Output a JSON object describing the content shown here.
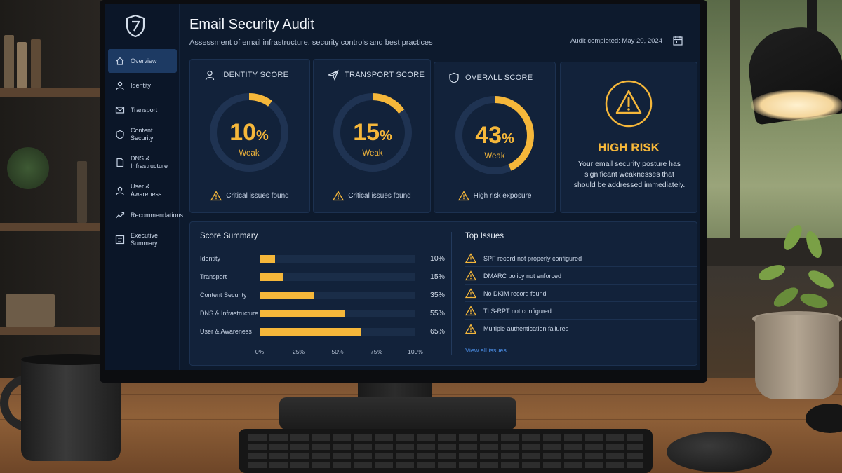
{
  "header": {
    "title": "Email Security Audit",
    "subtitle": "Assessment of email infrastructure, security controls and best practices",
    "audit_date": "Audit completed: May 20, 2024"
  },
  "sidebar": {
    "items": [
      {
        "label": "Overview",
        "icon": "home-icon",
        "active": true
      },
      {
        "label": "Identity",
        "icon": "user-icon",
        "active": false
      },
      {
        "label": "Transport",
        "icon": "mail-icon",
        "active": false
      },
      {
        "label": "Content Security",
        "icon": "shield-icon",
        "active": false
      },
      {
        "label": "DNS & Infrastructure",
        "icon": "document-icon",
        "active": false
      },
      {
        "label": "User & Awareness",
        "icon": "user-icon",
        "active": false
      },
      {
        "label": "Recommendations",
        "icon": "trend-icon",
        "active": false
      },
      {
        "label": "Executive Summary",
        "icon": "list-icon",
        "active": false
      }
    ]
  },
  "cards": {
    "identity": {
      "label": "IDENTITY SCORE",
      "value": "10",
      "percent": 10,
      "rating": "Weak",
      "note": "Critical issues found"
    },
    "transport": {
      "label": "TRANSPORT SCORE",
      "value": "15",
      "percent": 15,
      "rating": "Weak",
      "note": "Critical issues found"
    },
    "overall": {
      "label": "OVERALL SCORE",
      "value": "43",
      "percent": 43,
      "rating": "Weak",
      "note": "High risk exposure"
    },
    "pct_sign": "%"
  },
  "risk": {
    "title": "HIGH RISK",
    "description": "Your email security posture has significant weaknesses that should be addressed immediately."
  },
  "score_summary": {
    "title": "Score Summary",
    "rows": [
      {
        "label": "Identity",
        "percent": 10,
        "value_text": "10%"
      },
      {
        "label": "Transport",
        "percent": 15,
        "value_text": "15%"
      },
      {
        "label": "Content Security",
        "percent": 35,
        "value_text": "35%"
      },
      {
        "label": "DNS & Infrastructure",
        "percent": 55,
        "value_text": "55%"
      },
      {
        "label": "User & Awareness",
        "percent": 65,
        "value_text": "65%"
      }
    ],
    "axis": [
      "0%",
      "25%",
      "50%",
      "75%",
      "100%"
    ]
  },
  "top_issues": {
    "title": "Top Issues",
    "items": [
      "SPF record not properly configured",
      "DMARC policy not enforced",
      "No DKIM record found",
      "TLS-RPT not configured",
      "Multiple authentication failures"
    ],
    "view_all": "View all issues"
  },
  "colors": {
    "accent": "#f5b73a",
    "panel": "#12223a",
    "active_nav": "#1d3a63",
    "link": "#4b8fe8"
  }
}
